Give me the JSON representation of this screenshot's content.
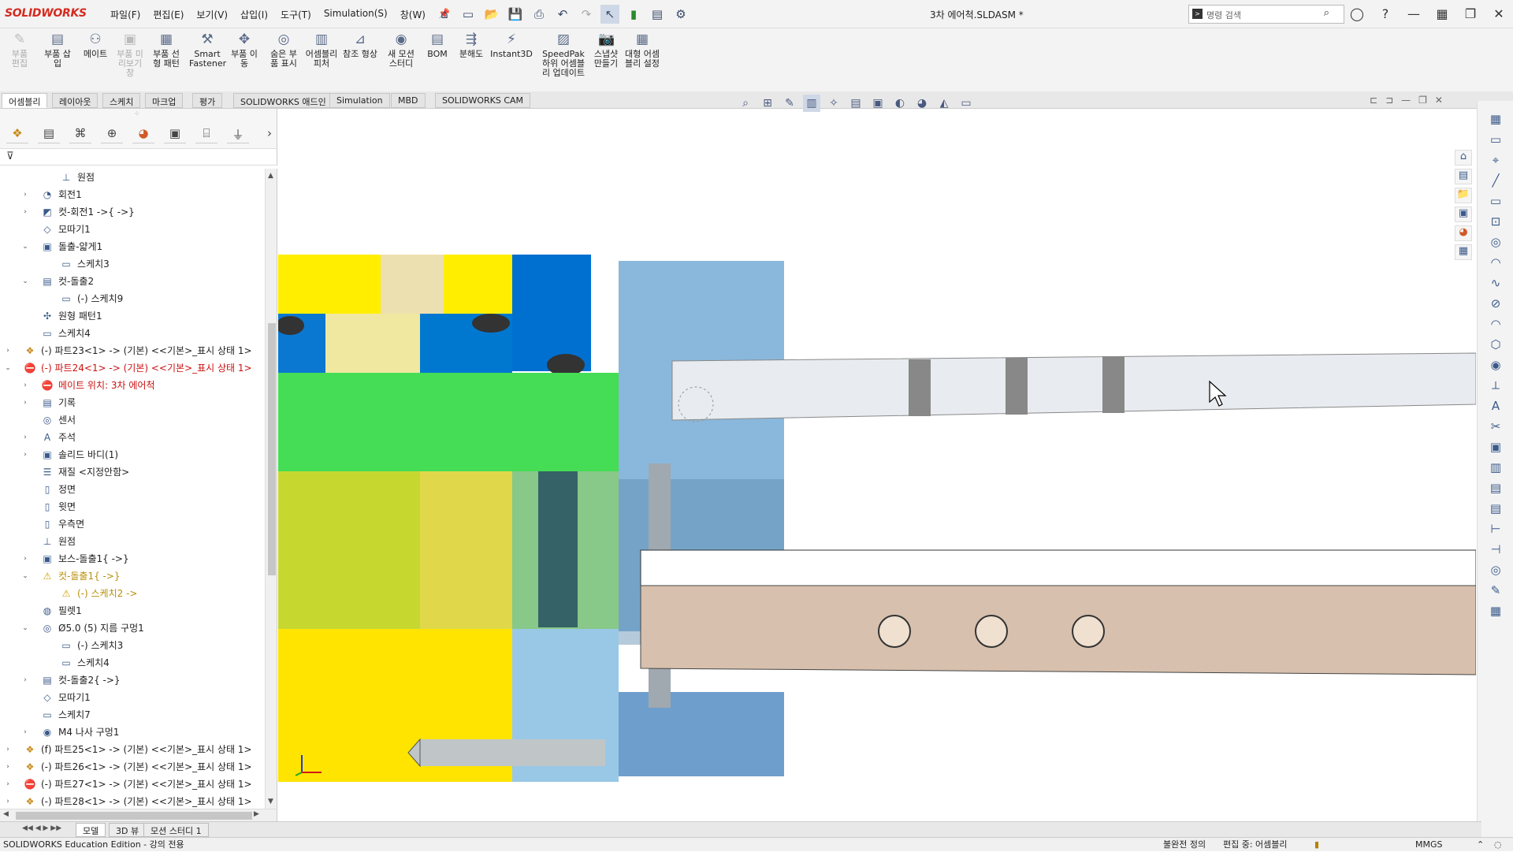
{
  "app": {
    "brand": "SOLIDWORKS",
    "document_title": "3차 에어척.SLDASM *"
  },
  "menus": [
    "파일(F)",
    "편집(E)",
    "보기(V)",
    "삽입(I)",
    "도구(T)",
    "Simulation(S)",
    "창(W)"
  ],
  "search": {
    "placeholder": "명령 검색"
  },
  "ribbon": [
    {
      "label": "부품 편집",
      "disabled": true
    },
    {
      "label": "부품 삽입",
      "disabled": false
    },
    {
      "label": "메이트",
      "disabled": false
    },
    {
      "label": "부품 미리보기 창",
      "disabled": true
    },
    {
      "label": "부품 선형 패턴",
      "disabled": false
    },
    {
      "label": "Smart Fastener",
      "disabled": false
    },
    {
      "label": "부품 이동",
      "disabled": false
    },
    {
      "label": "숨은 부품 표시",
      "disabled": false
    },
    {
      "label": "어셈블리 피처",
      "disabled": false
    },
    {
      "label": "참조 형상",
      "disabled": false
    },
    {
      "label": "새 모션 스터디",
      "disabled": false
    },
    {
      "label": "BOM",
      "disabled": false
    },
    {
      "label": "분해도",
      "disabled": false
    },
    {
      "label": "Instant3D",
      "disabled": false
    },
    {
      "label": "SpeedPak 하위 어셈블리 업데이트",
      "disabled": false
    },
    {
      "label": "스냅샷 만들기",
      "disabled": false
    },
    {
      "label": "대형 어셈블리 설정",
      "disabled": false
    }
  ],
  "tabs": [
    "어셈블리",
    "레이아웃",
    "스케치",
    "마크업",
    "평가",
    "SOLIDWORKS 애드인",
    "Simulation",
    "MBD",
    "SOLIDWORKS CAM"
  ],
  "tree": [
    {
      "level": 2,
      "label": "원점",
      "icon": "origin-icon",
      "arrow": "",
      "style": ""
    },
    {
      "level": 1,
      "label": "회전1",
      "icon": "revolve-icon",
      "arrow": "›",
      "style": ""
    },
    {
      "level": 1,
      "label": "컷-회전1 ->{ ->}",
      "icon": "cut-revolve-icon",
      "arrow": "›",
      "style": ""
    },
    {
      "level": 1,
      "label": "모따기1",
      "icon": "chamfer-icon",
      "arrow": "",
      "style": ""
    },
    {
      "level": 1,
      "label": "돌출-얇게1",
      "icon": "extrude-icon",
      "arrow": "⌄",
      "style": ""
    },
    {
      "level": 2,
      "label": "스케치3",
      "icon": "sketch-icon",
      "arrow": "",
      "style": ""
    },
    {
      "level": 1,
      "label": "컷-돌출2",
      "icon": "cut-extrude-icon",
      "arrow": "⌄",
      "style": ""
    },
    {
      "level": 2,
      "label": "(-) 스케치9",
      "icon": "sketch-icon",
      "arrow": "",
      "style": ""
    },
    {
      "level": 1,
      "label": "원형 패턴1",
      "icon": "circular-pattern-icon",
      "arrow": "",
      "style": ""
    },
    {
      "level": 1,
      "label": "스케치4",
      "icon": "sketch-icon",
      "arrow": "",
      "style": ""
    },
    {
      "level": 0,
      "label": "(-) 파트23<1> -> (기본) <<기본>_표시 상태 1>",
      "icon": "part-icon",
      "arrow": "›",
      "style": ""
    },
    {
      "level": 0,
      "label": "(-) 파트24<1> -> (기본) <<기본>_표시 상태 1>",
      "icon": "part-error-icon",
      "arrow": "⌄",
      "style": "red"
    },
    {
      "level": 1,
      "label": "메이트 위치: 3차 에어척",
      "icon": "error-icon",
      "arrow": "›",
      "style": "red"
    },
    {
      "level": 1,
      "label": "기록",
      "icon": "history-icon",
      "arrow": "›",
      "style": ""
    },
    {
      "level": 1,
      "label": "센서",
      "icon": "sensor-icon",
      "arrow": "",
      "style": ""
    },
    {
      "level": 1,
      "label": "주석",
      "icon": "annotation-icon",
      "arrow": "›",
      "style": ""
    },
    {
      "level": 1,
      "label": "솔리드 바디(1)",
      "icon": "solid-body-icon",
      "arrow": "›",
      "style": ""
    },
    {
      "level": 1,
      "label": "재질 <지정안함>",
      "icon": "material-icon",
      "arrow": "",
      "style": ""
    },
    {
      "level": 1,
      "label": "정면",
      "icon": "plane-icon",
      "arrow": "",
      "style": ""
    },
    {
      "level": 1,
      "label": "윗면",
      "icon": "plane-icon",
      "arrow": "",
      "style": ""
    },
    {
      "level": 1,
      "label": "우측면",
      "icon": "plane-icon",
      "arrow": "",
      "style": ""
    },
    {
      "level": 1,
      "label": "원점",
      "icon": "origin-icon",
      "arrow": "",
      "style": ""
    },
    {
      "level": 1,
      "label": "보스-돌출1{ ->}",
      "icon": "extrude-icon",
      "arrow": "›",
      "style": ""
    },
    {
      "level": 1,
      "label": "컷-돌출1{ ->}",
      "icon": "warning-icon",
      "arrow": "⌄",
      "style": "warn"
    },
    {
      "level": 2,
      "label": "(-) 스케치2 ->",
      "icon": "warning-icon",
      "arrow": "",
      "style": "warn"
    },
    {
      "level": 1,
      "label": "필렛1",
      "icon": "fillet-icon",
      "arrow": "",
      "style": ""
    },
    {
      "level": 1,
      "label": "Ø5.0 (5) 지름 구멍1",
      "icon": "hole-icon",
      "arrow": "⌄",
      "style": ""
    },
    {
      "level": 2,
      "label": "(-) 스케치3",
      "icon": "sketch-icon",
      "arrow": "",
      "style": ""
    },
    {
      "level": 2,
      "label": "스케치4",
      "icon": "sketch-icon",
      "arrow": "",
      "style": ""
    },
    {
      "level": 1,
      "label": "컷-돌출2{ ->}",
      "icon": "cut-extrude-icon",
      "arrow": "›",
      "style": ""
    },
    {
      "level": 1,
      "label": "모따기1",
      "icon": "chamfer-icon",
      "arrow": "",
      "style": ""
    },
    {
      "level": 1,
      "label": "스케치7",
      "icon": "sketch-icon",
      "arrow": "",
      "style": ""
    },
    {
      "level": 1,
      "label": "M4 나사 구멍1",
      "icon": "thread-hole-icon",
      "arrow": "›",
      "style": ""
    },
    {
      "level": 0,
      "label": "(f) 파트25<1> -> (기본) <<기본>_표시 상태 1>",
      "icon": "part-icon",
      "arrow": "›",
      "style": ""
    },
    {
      "level": 0,
      "label": "(-) 파트26<1> -> (기본) <<기본>_표시 상태 1>",
      "icon": "part-icon",
      "arrow": "›",
      "style": ""
    },
    {
      "level": 0,
      "label": "(-) 파트27<1> -> (기본) <<기본>_표시 상태 1>",
      "icon": "part-error-icon",
      "arrow": "›",
      "style": ""
    },
    {
      "level": 0,
      "label": "(-) 파트28<1> -> (기본) <<기본>_표시 상태 1>",
      "icon": "part-icon",
      "arrow": "›",
      "style": ""
    }
  ],
  "bottom_tabs": [
    "모델",
    "3D 뷰",
    "모션 스터디 1"
  ],
  "status": {
    "edition": "SOLIDWORKS Education Edition - 강의 전용",
    "definition": "불완전 정의",
    "editing": "편집 중: 어셈블리",
    "units": "MMGS"
  },
  "colors": {
    "brand": "#d52b1e",
    "error": "#cc1111",
    "warning": "#b8900a",
    "selected_tab": "#ffffff"
  }
}
